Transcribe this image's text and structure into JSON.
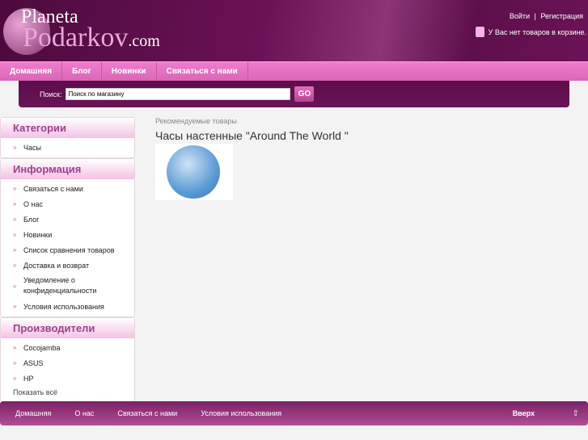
{
  "logo": {
    "line1": "Planeta",
    "line2": "Podarkov",
    ".com": ".com"
  },
  "top_links": {
    "login": "Войти",
    "sep": "|",
    "register": "Регистрация"
  },
  "cart": {
    "text": "У Вас нет товаров в корзине."
  },
  "nav": [
    "Домашняя",
    "Блог",
    "Новинки",
    "Связаться с нами"
  ],
  "search": {
    "label": "Поиск:",
    "value": "Поиск по магазину",
    "button": "GO"
  },
  "sidebar": {
    "categories": {
      "title": "Категории",
      "items": [
        "Часы"
      ]
    },
    "info": {
      "title": "Информация",
      "items": [
        "Связаться с нами",
        "О нас",
        "Блог",
        "Новинки",
        "Список сравнения товаров",
        "Доставка и возврат",
        "Уведомление о конфиденциальности",
        "Условия использования"
      ]
    },
    "manufacturers": {
      "title": "Производители",
      "items": [
        "Cocojamba",
        "ASUS",
        "HP"
      ],
      "show_all": "Показать всё"
    }
  },
  "main": {
    "section": "Рекомендуемые товары",
    "product_title": "Часы настенные \"Around The World \""
  },
  "footer": {
    "links": [
      "Домашняя",
      "О нас",
      "Связаться с нами",
      "Условия использования"
    ],
    "top": "Вверх",
    "arrow": "⇧"
  }
}
